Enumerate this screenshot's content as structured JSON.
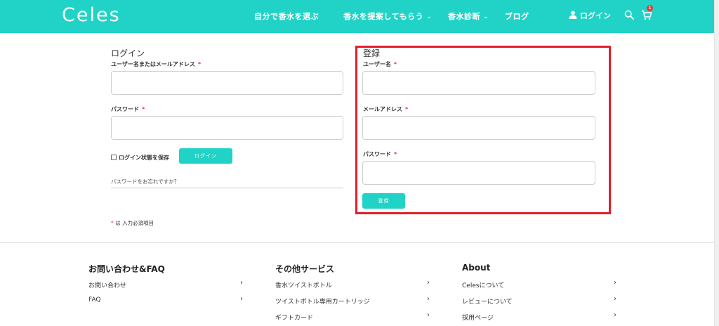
{
  "header": {
    "logo": "Celes",
    "nav": [
      {
        "label": "自分で香水を選ぶ"
      },
      {
        "label": "香水を提案してもらう"
      },
      {
        "label": "香水診断"
      },
      {
        "label": "ブログ"
      }
    ],
    "login_label": "ログイン",
    "cart_count": "1"
  },
  "login": {
    "title": "ログイン",
    "username_label": "ユーザー名またはメールアドレス",
    "password_label": "パスワード",
    "remember_label": "ログイン状態を保存",
    "submit_label": "ログイン",
    "forgot_label": "パスワードをお忘れですか？"
  },
  "register": {
    "title": "登録",
    "username_label": "ユーザー名",
    "email_label": "メールアドレス",
    "password_label": "パスワード",
    "submit_label": "登録"
  },
  "required_mark": "*",
  "required_note": "は 入力必須項目",
  "footer": {
    "columns": [
      {
        "heading": "お問い合わせ&FAQ",
        "links": [
          "お問い合わせ",
          "FAQ"
        ]
      },
      {
        "heading": "その他サービス",
        "links": [
          "香水ツイストボトル",
          "ツイストボトル専用カートリッジ",
          "ギフトカード"
        ]
      },
      {
        "heading": "About",
        "links": [
          "Celesについて",
          "レビューについて",
          "採用ページ"
        ]
      }
    ]
  },
  "colors": {
    "brand": "#21d3c6",
    "required": "#e53935",
    "highlight": "#e21f2b"
  }
}
